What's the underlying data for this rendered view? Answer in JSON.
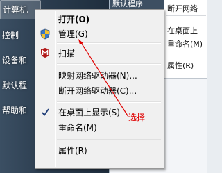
{
  "start_menu": {
    "items": [
      "计算机",
      "控制",
      "设备和",
      "默认程",
      "帮助和"
    ]
  },
  "background_window": {
    "tab_title": "默认程序",
    "menu_items": [
      "断开网络",
      "在桌面上",
      "重命名(M)",
      "属性(R)"
    ]
  },
  "context_menu": {
    "open": "打开(O)",
    "manage": "管理(G)",
    "scan": "扫描",
    "map_drive": "映射网络驱动器(N)...",
    "disconnect_drive": "断开网络驱动器(C)...",
    "show_on_desktop": "在桌面上显示(S)",
    "rename": "重命名(M)",
    "properties": "属性(R)",
    "icons": {
      "manage": "shield-icon",
      "scan": "antivirus-scan-icon",
      "show_on_desktop": "checkmark-icon"
    }
  },
  "annotation": {
    "text": "选择",
    "color": "#e00000"
  }
}
